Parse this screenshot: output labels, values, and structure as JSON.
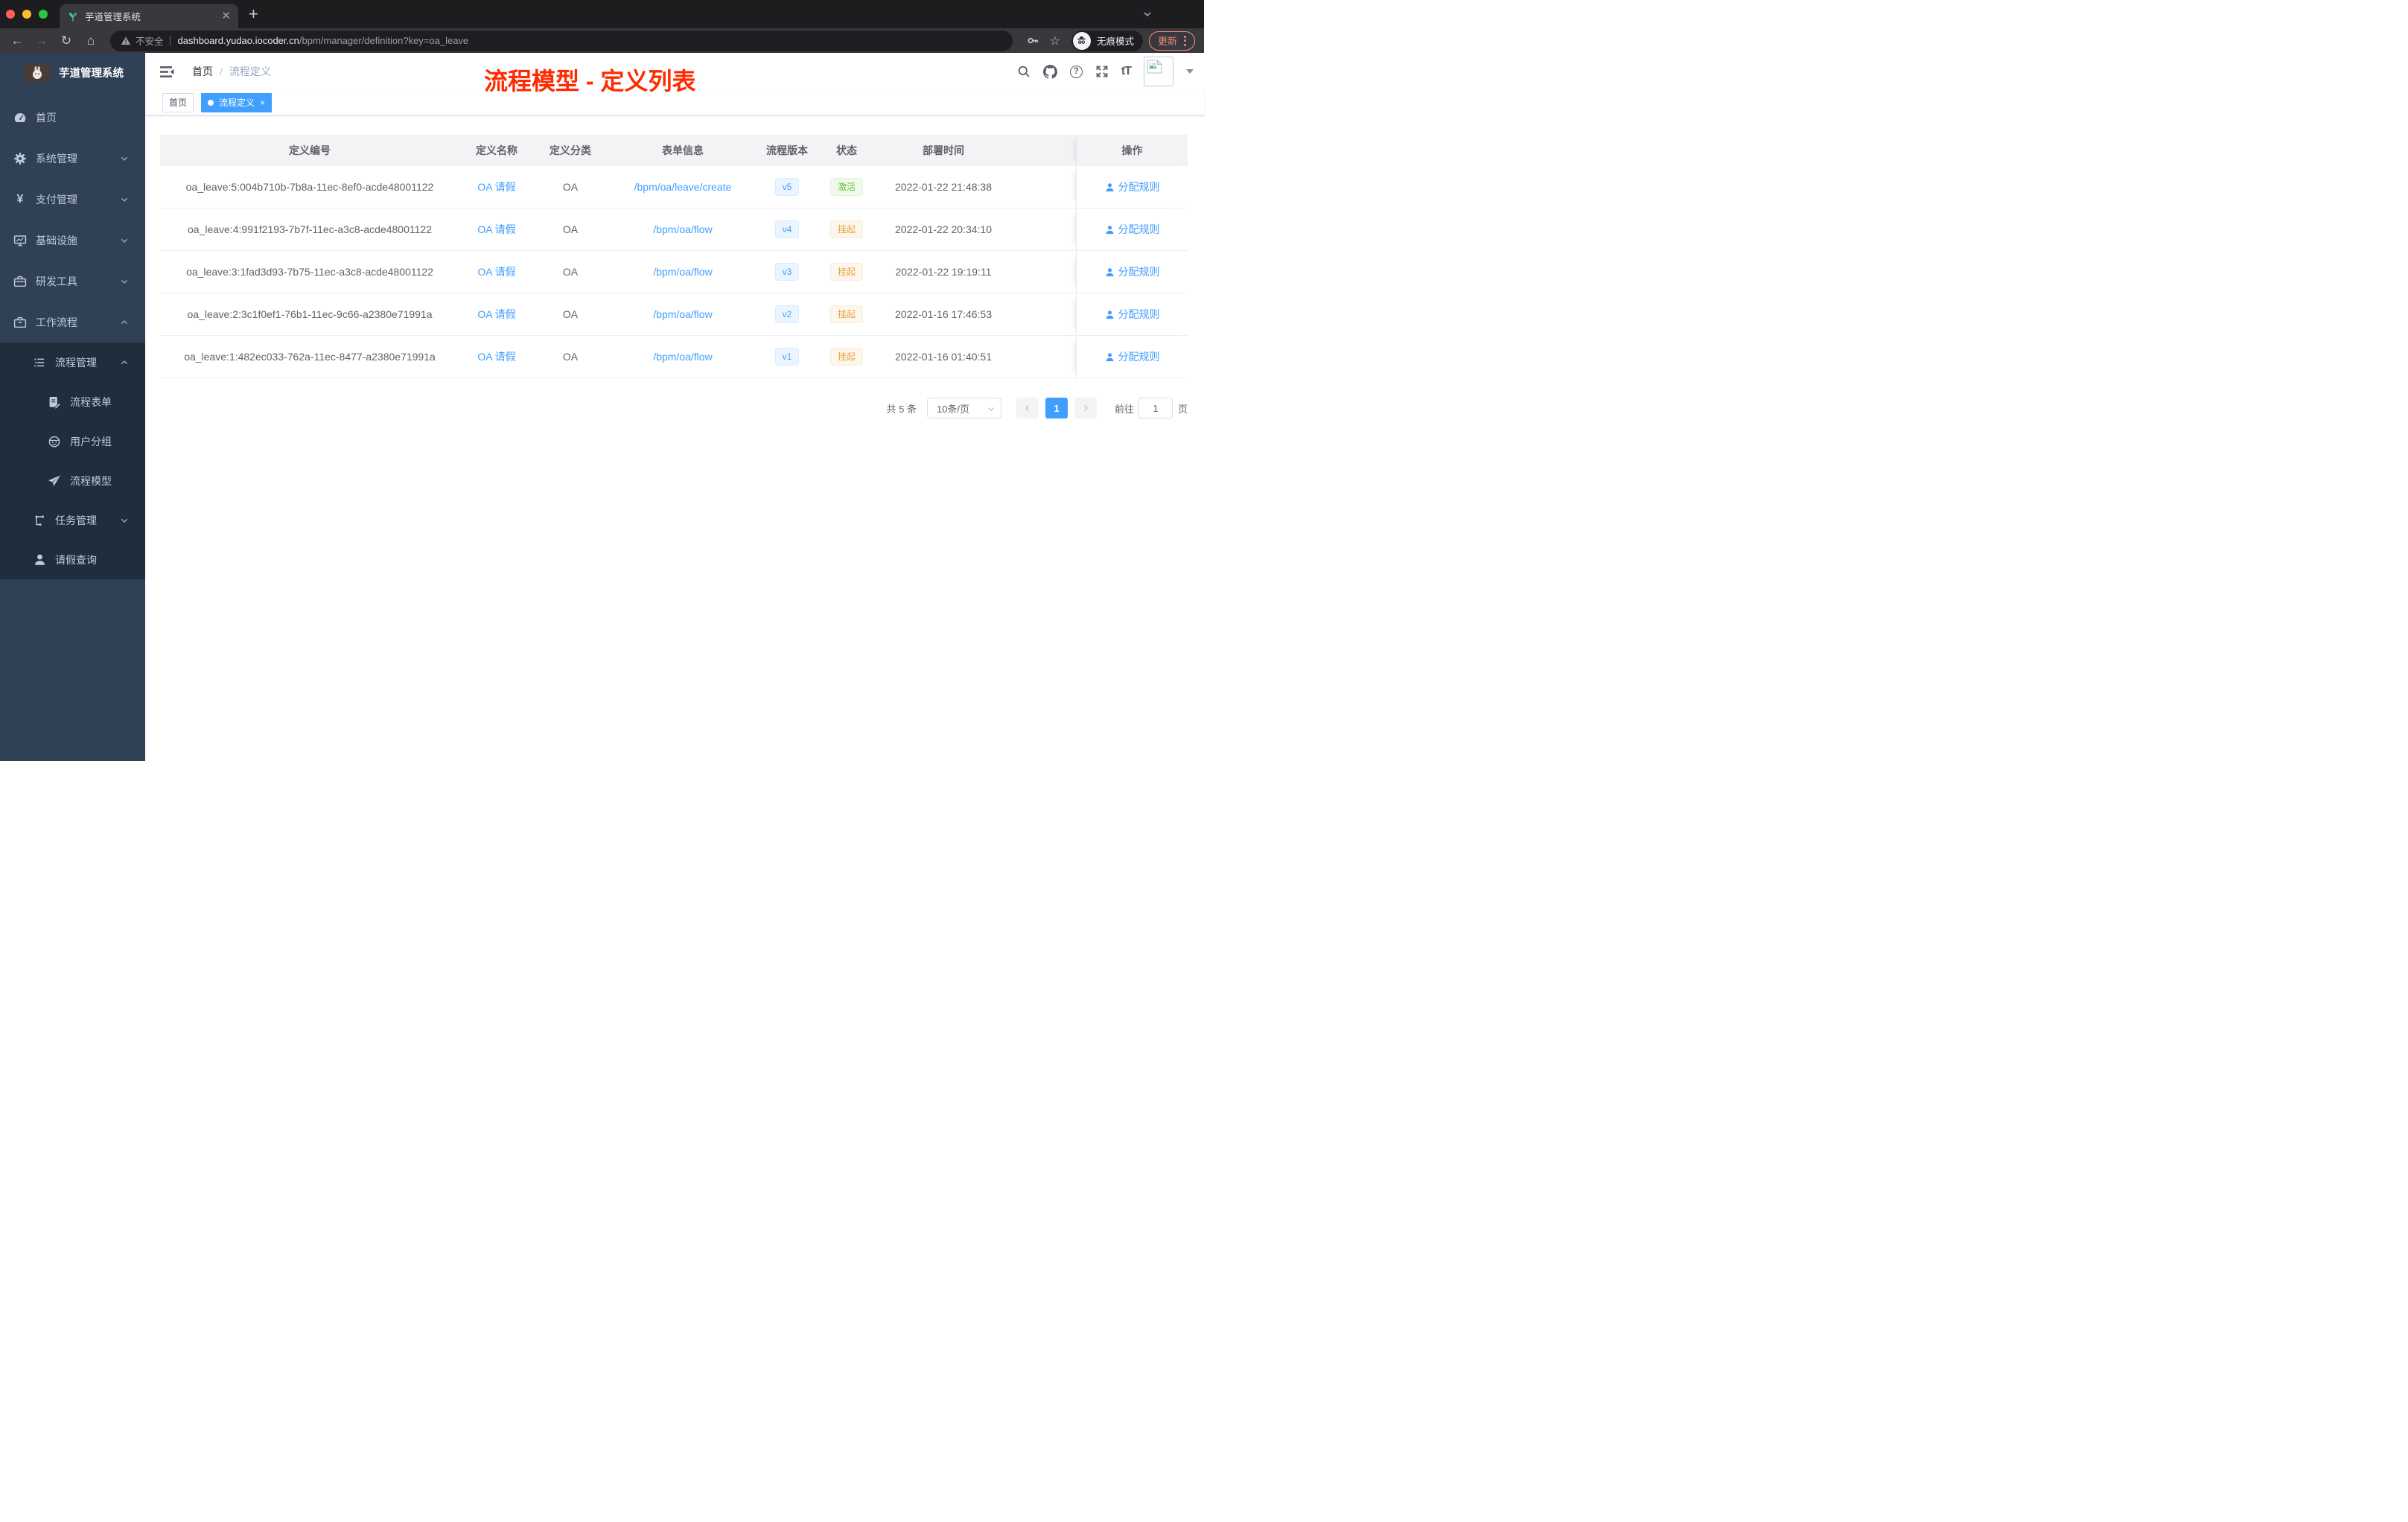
{
  "colors": {
    "accent": "#409eff",
    "annotation": "#ff2b00",
    "sidebar_bg": "#304156",
    "submenu_bg": "#1f2d3d",
    "sidebar_text": "#bfcbd9",
    "success": "#67c23a",
    "warning": "#e6a23c",
    "update": "#f28b82"
  },
  "browser": {
    "tab_title": "芋道管理系统",
    "security_label": "不安全",
    "url_domain": "dashboard.yudao.iocoder.cn",
    "url_path": "/bpm/manager/definition?key=oa_leave",
    "incognito_label": "无痕模式",
    "update_label": "更新"
  },
  "annotation": {
    "title": "流程模型 - 定义列表"
  },
  "sidebar": {
    "app_title": "芋道管理系统",
    "items": [
      {
        "key": "home",
        "label": "首页",
        "icon": "dashboard",
        "level": 1
      },
      {
        "key": "system",
        "label": "系统管理",
        "icon": "gear",
        "level": 1,
        "arrow": "down"
      },
      {
        "key": "payment",
        "label": "支付管理",
        "icon": "yen",
        "level": 1,
        "arrow": "down"
      },
      {
        "key": "infrastructure",
        "label": "基础设施",
        "icon": "monitor",
        "level": 1,
        "arrow": "down"
      },
      {
        "key": "devtools",
        "label": "研发工具",
        "icon": "toolbox",
        "level": 1,
        "arrow": "down"
      },
      {
        "key": "workflow",
        "label": "工作流程",
        "icon": "briefcase",
        "level": 1,
        "arrow": "up"
      },
      {
        "key": "process-management",
        "label": "流程管理",
        "icon": "list",
        "level": 2,
        "arrow": "up",
        "dark": true
      },
      {
        "key": "process-form",
        "label": "流程表单",
        "icon": "doc",
        "level": 3,
        "dark": true
      },
      {
        "key": "user-group",
        "label": "用户分组",
        "icon": "robot",
        "level": 3,
        "dark": true
      },
      {
        "key": "process-model",
        "label": "流程模型",
        "icon": "plane",
        "level": 3,
        "dark": true
      },
      {
        "key": "task-management",
        "label": "任务管理",
        "icon": "tree",
        "level": 2,
        "arrow": "down",
        "dark": true
      },
      {
        "key": "leave-query",
        "label": "请假查询",
        "icon": "user",
        "level": 2,
        "dark": true
      }
    ]
  },
  "header": {
    "breadcrumb": {
      "home": "首页",
      "separator": "/",
      "current": "流程定义"
    },
    "size_icon_text": "tT"
  },
  "tags": [
    {
      "label": "首页",
      "active": false
    },
    {
      "label": "流程定义",
      "active": true,
      "closable": true
    }
  ],
  "table": {
    "columns": [
      "定义编号",
      "定义名称",
      "定义分类",
      "表单信息",
      "流程版本",
      "状态",
      "部署时间",
      "操作"
    ],
    "rows": [
      {
        "id": "oa_leave:5:004b710b-7b8a-11ec-8ef0-acde48001122",
        "name": "OA 请假",
        "category": "OA",
        "form": "/bpm/oa/leave/create",
        "version": "v5",
        "status": "激活",
        "status_type": "success",
        "time": "2022-01-22 21:48:38",
        "action": "分配规则"
      },
      {
        "id": "oa_leave:4:991f2193-7b7f-11ec-a3c8-acde48001122",
        "name": "OA 请假",
        "category": "OA",
        "form": "/bpm/oa/flow",
        "version": "v4",
        "status": "挂起",
        "status_type": "warning",
        "time": "2022-01-22 20:34:10",
        "action": "分配规则"
      },
      {
        "id": "oa_leave:3:1fad3d93-7b75-11ec-a3c8-acde48001122",
        "name": "OA 请假",
        "category": "OA",
        "form": "/bpm/oa/flow",
        "version": "v3",
        "status": "挂起",
        "status_type": "warning",
        "time": "2022-01-22 19:19:11",
        "action": "分配规则"
      },
      {
        "id": "oa_leave:2:3c1f0ef1-76b1-11ec-9c66-a2380e71991a",
        "name": "OA 请假",
        "category": "OA",
        "form": "/bpm/oa/flow",
        "version": "v2",
        "status": "挂起",
        "status_type": "warning",
        "time": "2022-01-16 17:46:53",
        "action": "分配规则"
      },
      {
        "id": "oa_leave:1:482ec033-762a-11ec-8477-a2380e71991a",
        "name": "OA 请假",
        "category": "OA",
        "form": "/bpm/oa/flow",
        "version": "v1",
        "status": "挂起",
        "status_type": "warning",
        "time": "2022-01-16 01:40:51",
        "action": "分配规则"
      }
    ]
  },
  "pagination": {
    "total": "共 5 条",
    "page_size": "10条/页",
    "current": "1",
    "goto_label": "前往",
    "goto_value": "1",
    "page_unit": "页"
  }
}
